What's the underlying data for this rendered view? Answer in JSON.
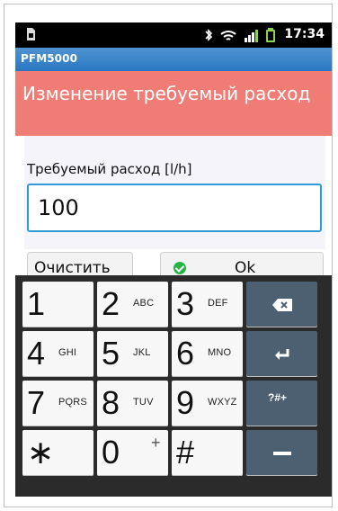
{
  "status": {
    "time": "17:34",
    "icons": [
      "sim-card-icon",
      "bluetooth-icon",
      "wifi-icon",
      "signal-bars-icon",
      "battery-icon"
    ]
  },
  "app": {
    "title": "PFM5000"
  },
  "dialog": {
    "heading": "Изменение требуемый расход",
    "field_label": "Требуемый расход [l/h]",
    "field_value": "100",
    "buttons": {
      "clear_label": "Очистить",
      "ok_label": "Ok"
    }
  },
  "keypad": {
    "keys": [
      {
        "main": "1",
        "sub": ""
      },
      {
        "main": "2",
        "sub": "ABC"
      },
      {
        "main": "3",
        "sub": "DEF"
      },
      {
        "main": "",
        "sub": "",
        "icon": "backspace-icon"
      },
      {
        "main": "4",
        "sub": "GHI"
      },
      {
        "main": "5",
        "sub": "JKL"
      },
      {
        "main": "6",
        "sub": "MNO"
      },
      {
        "main": "",
        "sub": "",
        "icon": "enter-icon"
      },
      {
        "main": "7",
        "sub": "PQRS"
      },
      {
        "main": "8",
        "sub": "TUV"
      },
      {
        "main": "9",
        "sub": "WXYZ"
      },
      {
        "main": "?#+",
        "sub": ""
      },
      {
        "main": "∗",
        "sub": ""
      },
      {
        "main": "0",
        "sub": "+"
      },
      {
        "main": "#",
        "sub": ""
      },
      {
        "main": "",
        "sub": "",
        "icon": "minus-icon"
      }
    ]
  },
  "colors": {
    "header_bg": "#ef7d76",
    "appbar_bg": "#2a78c2",
    "field_border": "#2e9bd6",
    "keypad_bg": "#2b2b2b",
    "function_key_bg": "#4d6071",
    "ok_icon": "#26b545"
  }
}
